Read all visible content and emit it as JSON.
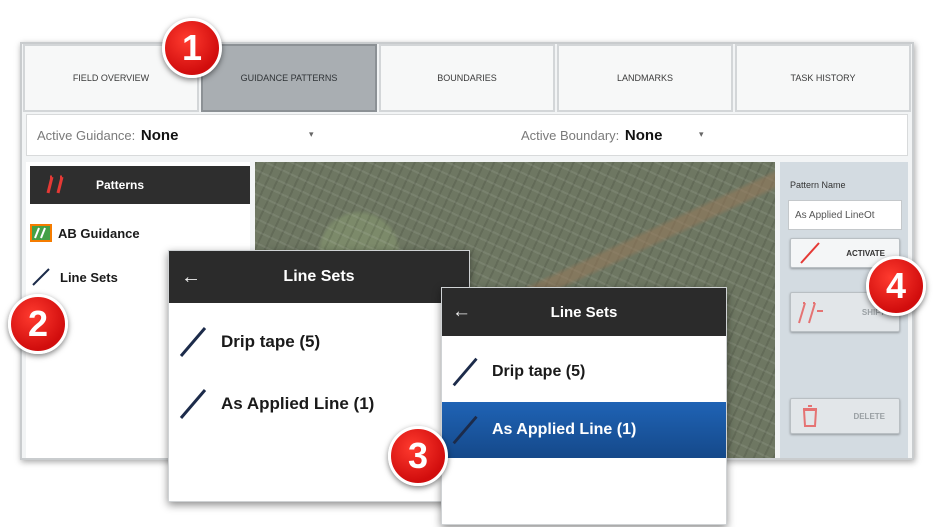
{
  "tabs": [
    {
      "label": "FIELD OVERVIEW"
    },
    {
      "label": "GUIDANCE PATTERNS",
      "active": true
    },
    {
      "label": "BOUNDARIES"
    },
    {
      "label": "LANDMARKS"
    },
    {
      "label": "TASK HISTORY"
    }
  ],
  "guidance_bar": {
    "active_guidance_label": "Active Guidance:",
    "active_guidance_value": "None",
    "active_boundary_label": "Active Boundary:",
    "active_boundary_value": "None"
  },
  "left_panel": {
    "patterns_label": "Patterns",
    "items": [
      {
        "label": "AB Guidance",
        "icon": "ab-guidance-icon"
      },
      {
        "label": "Line Sets",
        "icon": "line-icon"
      }
    ]
  },
  "right_panel": {
    "pattern_name_label": "Pattern Name",
    "pattern_name_value": "As Applied LineOt",
    "activate_label": "ACTIVATE",
    "shift_label": "SHIFT",
    "delete_label": "DELETE"
  },
  "line_sets_panel_1": {
    "title": "Line Sets",
    "items": [
      {
        "label": "Drip tape (5)"
      },
      {
        "label": "As Applied Line (1)"
      }
    ]
  },
  "line_sets_panel_2": {
    "title": "Line Sets",
    "items": [
      {
        "label": "Drip tape (5)"
      },
      {
        "label": "As Applied Line (1)",
        "selected": true
      }
    ]
  },
  "callouts": [
    "1",
    "2",
    "3",
    "4"
  ],
  "colors": {
    "selected_row": "#1f63b5",
    "callout_red": "#e3150f",
    "header_dark": "#2b2b2b"
  }
}
